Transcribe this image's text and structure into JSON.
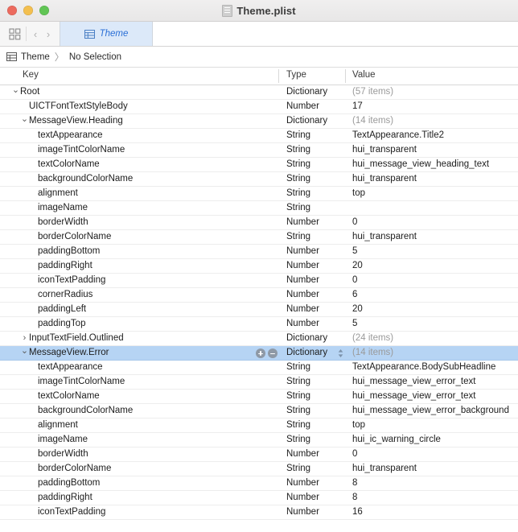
{
  "window": {
    "title": "Theme.plist",
    "doc_icon": "document-icon",
    "traffic_lights": [
      {
        "name": "close-button",
        "color": "#ec6a5e"
      },
      {
        "name": "minimize-button",
        "color": "#f3bf4f"
      },
      {
        "name": "maximize-button",
        "color": "#61c555"
      }
    ]
  },
  "toolbar": {
    "grid_icon": "grid-layout-icon",
    "back_label": "‹",
    "forward_label": "›",
    "tab": {
      "icon": "table-icon",
      "label": "Theme"
    }
  },
  "jumpbar": {
    "icon": "table-icon",
    "root_label": "Theme",
    "separator": "〉",
    "selection_label": "No Selection"
  },
  "table": {
    "columns": [
      "Key",
      "Type",
      "Value"
    ],
    "rows": [
      {
        "indent": 0,
        "disclosure": "expanded",
        "key": "Root",
        "type": "Dictionary",
        "value": "(57 items)",
        "muted": true,
        "selected": false
      },
      {
        "indent": 1,
        "disclosure": "none",
        "key": "UICTFontTextStyleBody",
        "type": "Number",
        "value": "17",
        "muted": false,
        "selected": false
      },
      {
        "indent": 1,
        "disclosure": "expanded",
        "key": "MessageView.Heading",
        "type": "Dictionary",
        "value": "(14 items)",
        "muted": true,
        "selected": false
      },
      {
        "indent": 2,
        "disclosure": "none",
        "key": "textAppearance",
        "type": "String",
        "value": "TextAppearance.Title2",
        "muted": false,
        "selected": false
      },
      {
        "indent": 2,
        "disclosure": "none",
        "key": "imageTintColorName",
        "type": "String",
        "value": "hui_transparent",
        "muted": false,
        "selected": false
      },
      {
        "indent": 2,
        "disclosure": "none",
        "key": "textColorName",
        "type": "String",
        "value": "hui_message_view_heading_text",
        "muted": false,
        "selected": false
      },
      {
        "indent": 2,
        "disclosure": "none",
        "key": "backgroundColorName",
        "type": "String",
        "value": "hui_transparent",
        "muted": false,
        "selected": false
      },
      {
        "indent": 2,
        "disclosure": "none",
        "key": "alignment",
        "type": "String",
        "value": "top",
        "muted": false,
        "selected": false
      },
      {
        "indent": 2,
        "disclosure": "none",
        "key": "imageName",
        "type": "String",
        "value": "",
        "muted": false,
        "selected": false
      },
      {
        "indent": 2,
        "disclosure": "none",
        "key": "borderWidth",
        "type": "Number",
        "value": "0",
        "muted": false,
        "selected": false
      },
      {
        "indent": 2,
        "disclosure": "none",
        "key": "borderColorName",
        "type": "String",
        "value": "hui_transparent",
        "muted": false,
        "selected": false
      },
      {
        "indent": 2,
        "disclosure": "none",
        "key": "paddingBottom",
        "type": "Number",
        "value": "5",
        "muted": false,
        "selected": false
      },
      {
        "indent": 2,
        "disclosure": "none",
        "key": "paddingRight",
        "type": "Number",
        "value": "20",
        "muted": false,
        "selected": false
      },
      {
        "indent": 2,
        "disclosure": "none",
        "key": "iconTextPadding",
        "type": "Number",
        "value": "0",
        "muted": false,
        "selected": false
      },
      {
        "indent": 2,
        "disclosure": "none",
        "key": "cornerRadius",
        "type": "Number",
        "value": "6",
        "muted": false,
        "selected": false
      },
      {
        "indent": 2,
        "disclosure": "none",
        "key": "paddingLeft",
        "type": "Number",
        "value": "20",
        "muted": false,
        "selected": false
      },
      {
        "indent": 2,
        "disclosure": "none",
        "key": "paddingTop",
        "type": "Number",
        "value": "5",
        "muted": false,
        "selected": false
      },
      {
        "indent": 1,
        "disclosure": "collapsed",
        "key": "InputTextField.Outlined",
        "type": "Dictionary",
        "value": "(24 items)",
        "muted": true,
        "selected": false
      },
      {
        "indent": 1,
        "disclosure": "expanded",
        "key": "MessageView.Error",
        "type": "Dictionary",
        "value": "(14 items)",
        "muted": true,
        "selected": true
      },
      {
        "indent": 2,
        "disclosure": "none",
        "key": "textAppearance",
        "type": "String",
        "value": "TextAppearance.BodySubHeadline",
        "muted": false,
        "selected": false
      },
      {
        "indent": 2,
        "disclosure": "none",
        "key": "imageTintColorName",
        "type": "String",
        "value": "hui_message_view_error_text",
        "muted": false,
        "selected": false
      },
      {
        "indent": 2,
        "disclosure": "none",
        "key": "textColorName",
        "type": "String",
        "value": "hui_message_view_error_text",
        "muted": false,
        "selected": false
      },
      {
        "indent": 2,
        "disclosure": "none",
        "key": "backgroundColorName",
        "type": "String",
        "value": "hui_message_view_error_background",
        "muted": false,
        "selected": false
      },
      {
        "indent": 2,
        "disclosure": "none",
        "key": "alignment",
        "type": "String",
        "value": "top",
        "muted": false,
        "selected": false
      },
      {
        "indent": 2,
        "disclosure": "none",
        "key": "imageName",
        "type": "String",
        "value": "hui_ic_warning_circle",
        "muted": false,
        "selected": false
      },
      {
        "indent": 2,
        "disclosure": "none",
        "key": "borderWidth",
        "type": "Number",
        "value": "0",
        "muted": false,
        "selected": false
      },
      {
        "indent": 2,
        "disclosure": "none",
        "key": "borderColorName",
        "type": "String",
        "value": "hui_transparent",
        "muted": false,
        "selected": false
      },
      {
        "indent": 2,
        "disclosure": "none",
        "key": "paddingBottom",
        "type": "Number",
        "value": "8",
        "muted": false,
        "selected": false
      },
      {
        "indent": 2,
        "disclosure": "none",
        "key": "paddingRight",
        "type": "Number",
        "value": "8",
        "muted": false,
        "selected": false
      },
      {
        "indent": 2,
        "disclosure": "none",
        "key": "iconTextPadding",
        "type": "Number",
        "value": "16",
        "muted": false,
        "selected": false
      }
    ],
    "selected_row_controls": {
      "add_label": "add-row-button",
      "remove_label": "remove-row-button",
      "type_popup": "type-popup-arrows"
    }
  },
  "colors": {
    "selection": "#b6d4f4",
    "tab_active": "#dce9f9",
    "accent_text": "#2a6fd6",
    "muted_text": "#9a9a9a"
  }
}
